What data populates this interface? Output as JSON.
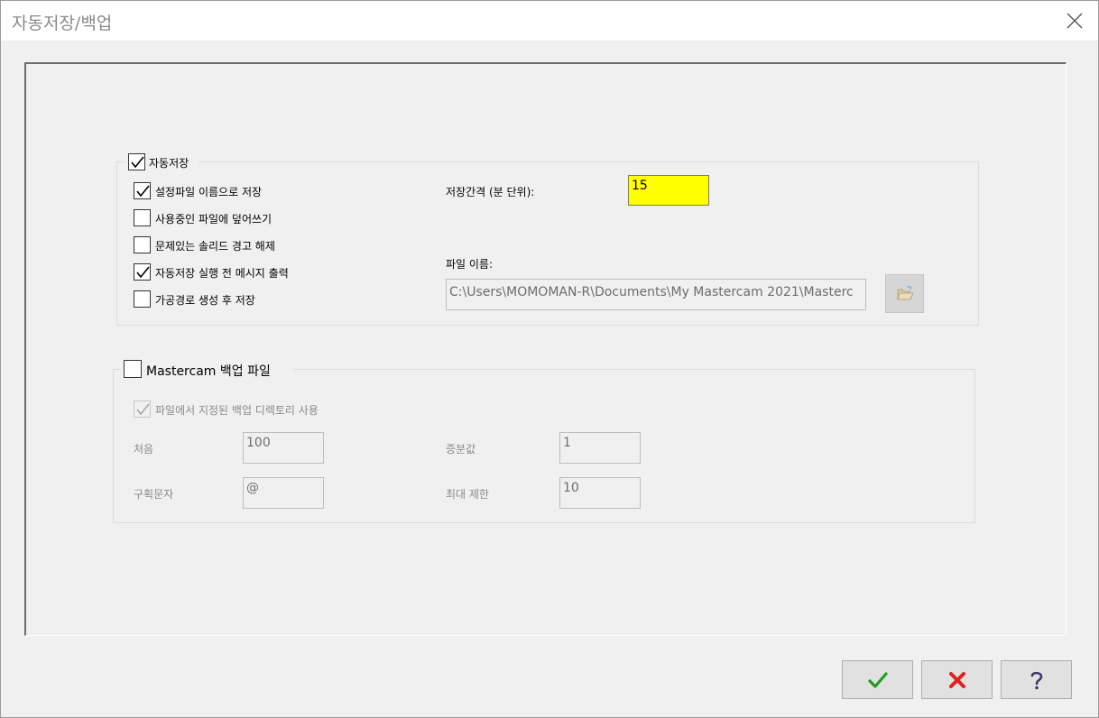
{
  "window": {
    "title": "자동저장/백업"
  },
  "autosave": {
    "group_label": "자동저장",
    "checked": true,
    "options": [
      {
        "label": "설정파일 이름으로 저장",
        "checked": true
      },
      {
        "label": "사용중인 파일에 덮어쓰기",
        "checked": false
      },
      {
        "label": "문제있는 솔리드 경고 해제",
        "checked": false
      },
      {
        "label": "자동저장 실행 전 메시지 출력",
        "checked": true
      },
      {
        "label": "가공경로 생성 후 저장",
        "checked": false
      }
    ],
    "interval_label": "저장간격 (분 단위):",
    "interval_value": "15",
    "filename_label": "파일 이름:",
    "filename_value": "C:\\Users\\MOMOMAN-R\\Documents\\My Mastercam 2021\\Masterc"
  },
  "backup": {
    "group_label": "Mastercam 백업 파일",
    "checked": false,
    "use_dir_label": "파일에서 지정된 백업 디렉토리 사용",
    "use_dir_checked": true,
    "first_label": "처음",
    "first_value": "100",
    "increment_label": "증분값",
    "increment_value": "1",
    "delimiter_label": "구획문자",
    "delimiter_value": "@",
    "max_label": "최대 제한",
    "max_value": "10"
  },
  "icons": {
    "ok": "green-check-icon",
    "cancel": "red-x-icon",
    "help": "question-mark-icon",
    "folder": "folder-open-icon",
    "close": "close-icon"
  },
  "colors": {
    "interval_bg": "#ffff00",
    "ok_green": "#1f9e1f",
    "cancel_red": "#e02020"
  }
}
